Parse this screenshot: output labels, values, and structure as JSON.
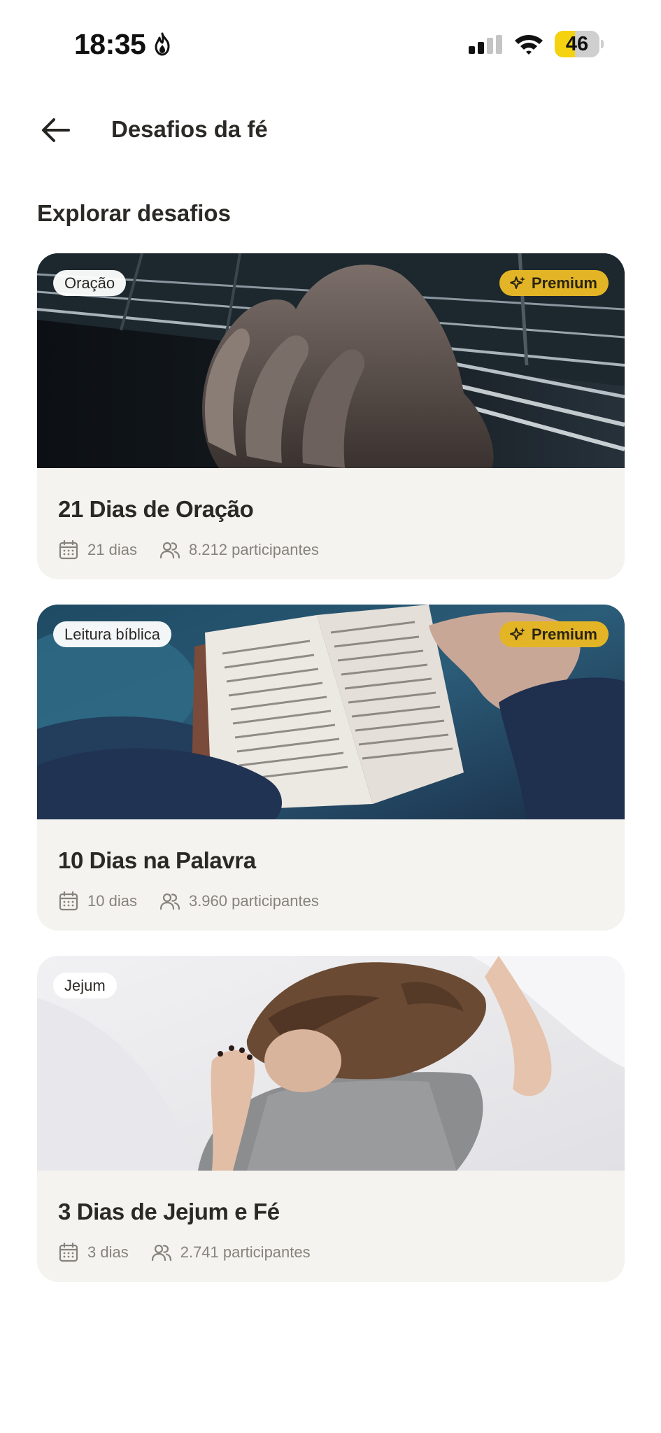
{
  "status_bar": {
    "time": "18:35",
    "battery": "46",
    "battery_level": 0.46
  },
  "header": {
    "title": "Desafios da fé"
  },
  "section": {
    "title": "Explorar desafios"
  },
  "premium_label": "Premium",
  "cards": [
    {
      "tag": "Oração",
      "premium": true,
      "title": "21 Dias de Oração",
      "duration": "21 dias",
      "participants": "8.212 participantes"
    },
    {
      "tag": "Leitura bíblica",
      "premium": true,
      "title": "10 Dias na Palavra",
      "duration": "10 dias",
      "participants": "3.960 participantes"
    },
    {
      "tag": "Jejum",
      "premium": false,
      "title": "3 Dias de Jejum e Fé",
      "duration": "3 dias",
      "participants": "2.741 participantes"
    }
  ],
  "colors": {
    "accent": "#e3b526",
    "card_bg": "#f4f3ef",
    "battery_fill": "#f5d20f"
  }
}
